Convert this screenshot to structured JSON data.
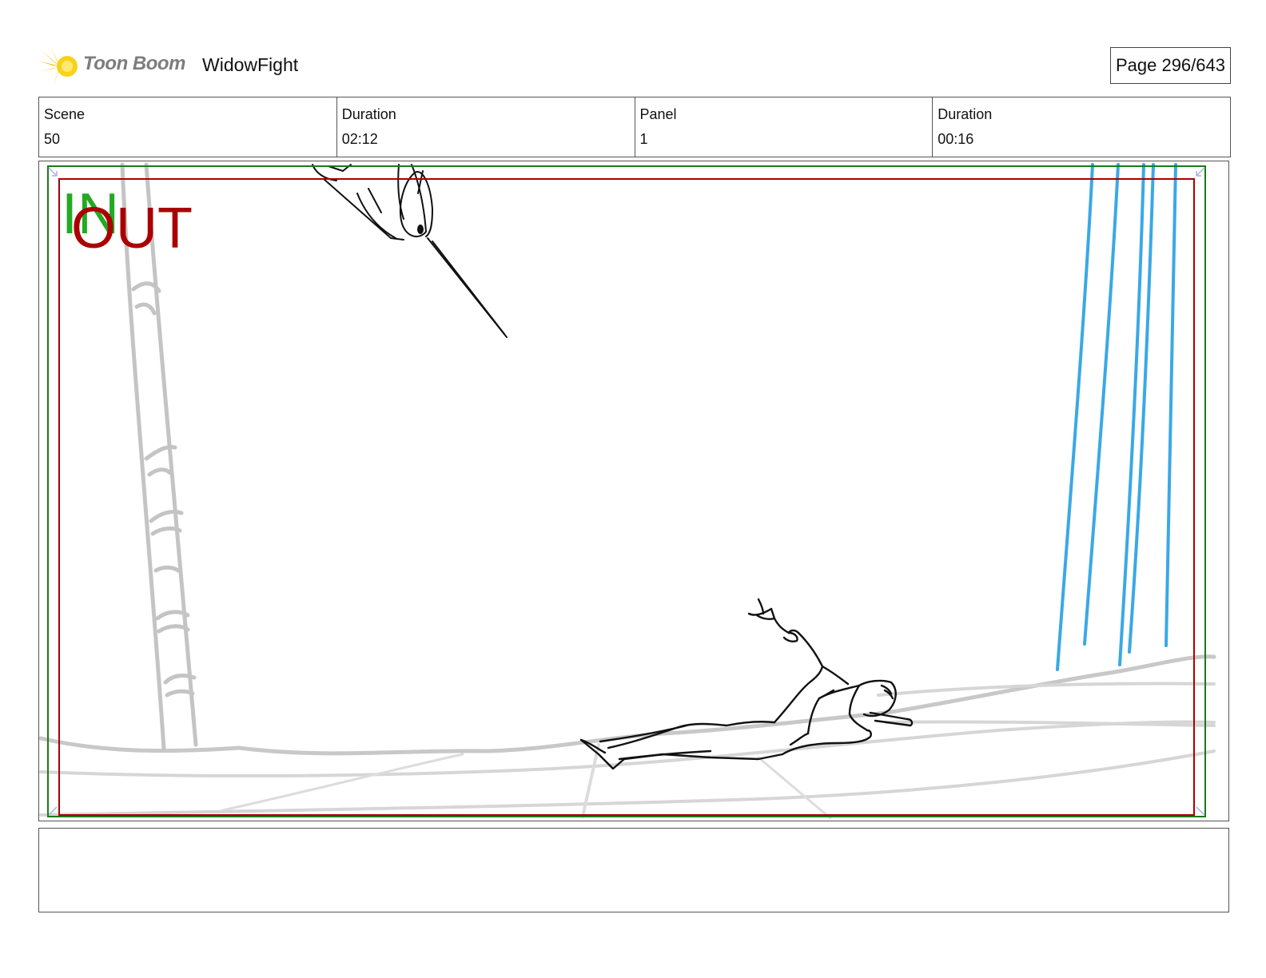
{
  "header": {
    "brand": "Toon Boom",
    "project": "WidowFight",
    "page": "Page 296/643"
  },
  "info": {
    "scene_label": "Scene",
    "scene_value": "50",
    "scene_duration_label": "Duration",
    "scene_duration_value": "02:12",
    "panel_label": "Panel",
    "panel_value": "1",
    "panel_duration_label": "Duration",
    "panel_duration_value": "00:16"
  },
  "panel": {
    "in_marker": "IN",
    "out_marker": "OUT",
    "colors": {
      "in_frame": "#1a7a1a",
      "out_frame": "#aa0000",
      "rain": "#3aa8e6",
      "sketch": "#111111",
      "background_lines": "#c8c8c8"
    }
  },
  "caption": {
    "text": ""
  }
}
